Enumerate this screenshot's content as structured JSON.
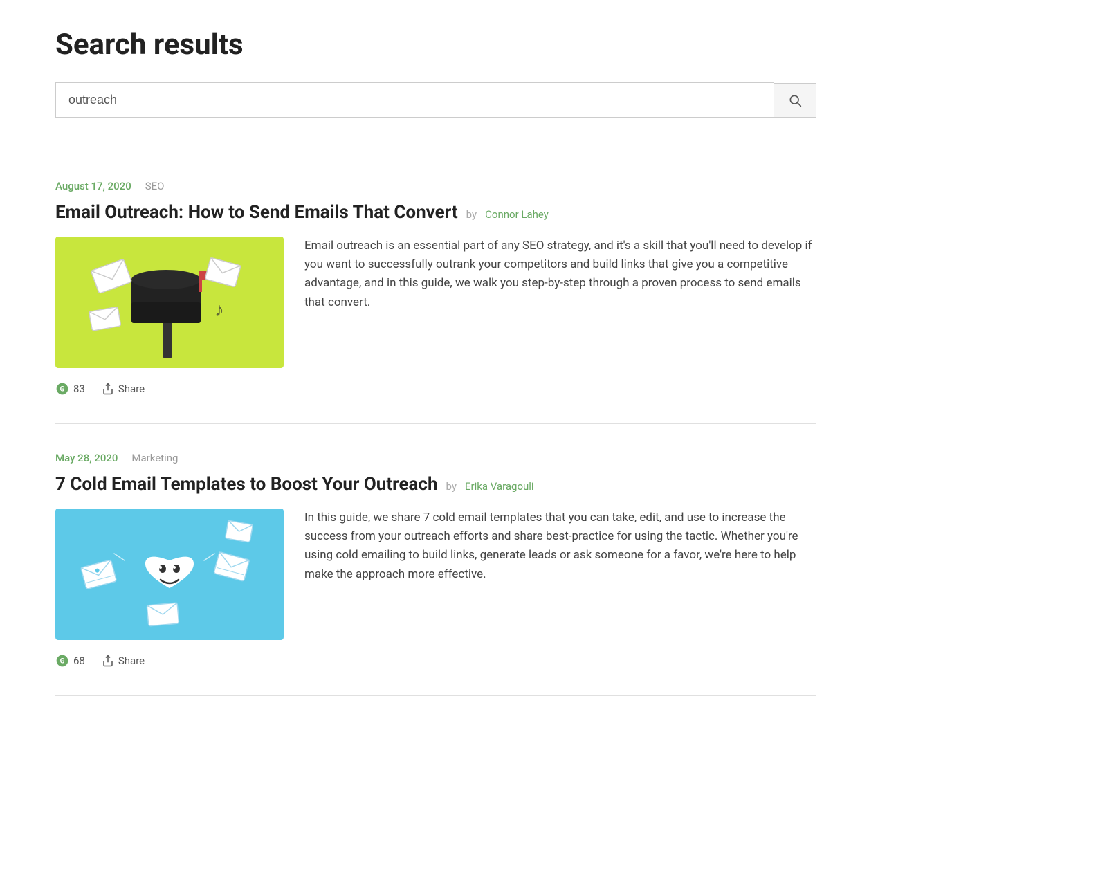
{
  "page": {
    "title": "Search results"
  },
  "search": {
    "value": "outreach",
    "placeholder": "outreach",
    "button_label": "Search"
  },
  "results": [
    {
      "id": 1,
      "date": "August 17, 2020",
      "category": "SEO",
      "title": "Email Outreach: How to Send Emails That Convert",
      "by": "by",
      "author": "Connor Lahey",
      "description": "Email outreach is an essential part of any SEO strategy, and it's a skill that you'll need to develop if you want to successfully outrank your competitors and build links that give you a competitive advantage, and in this guide, we walk you step-by-step through a proven process to send emails that convert.",
      "votes": 83,
      "share_label": "Share"
    },
    {
      "id": 2,
      "date": "May 28, 2020",
      "category": "Marketing",
      "title": "7 Cold Email Templates to Boost Your Outreach",
      "by": "by",
      "author": "Erika Varagouli",
      "description": "In this guide, we share 7 cold email templates that you can take, edit, and use to increase the success from your outreach efforts and share best-practice for using the tactic. Whether you're using cold emailing to build links, generate leads or ask someone for a favor, we're here to help make the approach more effective.",
      "votes": 68,
      "share_label": "Share"
    }
  ]
}
